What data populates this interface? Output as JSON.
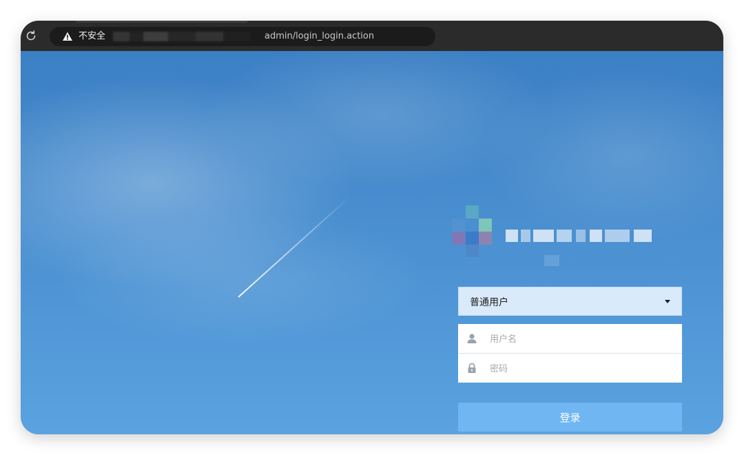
{
  "browser": {
    "security_label": "不安全",
    "url": "admin/login_login.action"
  },
  "login": {
    "role_select": {
      "selected": "普通用户"
    },
    "username_placeholder": "用户名",
    "password_placeholder": "密码",
    "submit_label": "登录"
  },
  "colors": {
    "background_top": "#3b7fc4",
    "background_bottom": "#5aa2e0",
    "select_bg": "#d9eafa",
    "button_bg": "#6fb6f2",
    "browser_bar": "#2b2b2b"
  }
}
